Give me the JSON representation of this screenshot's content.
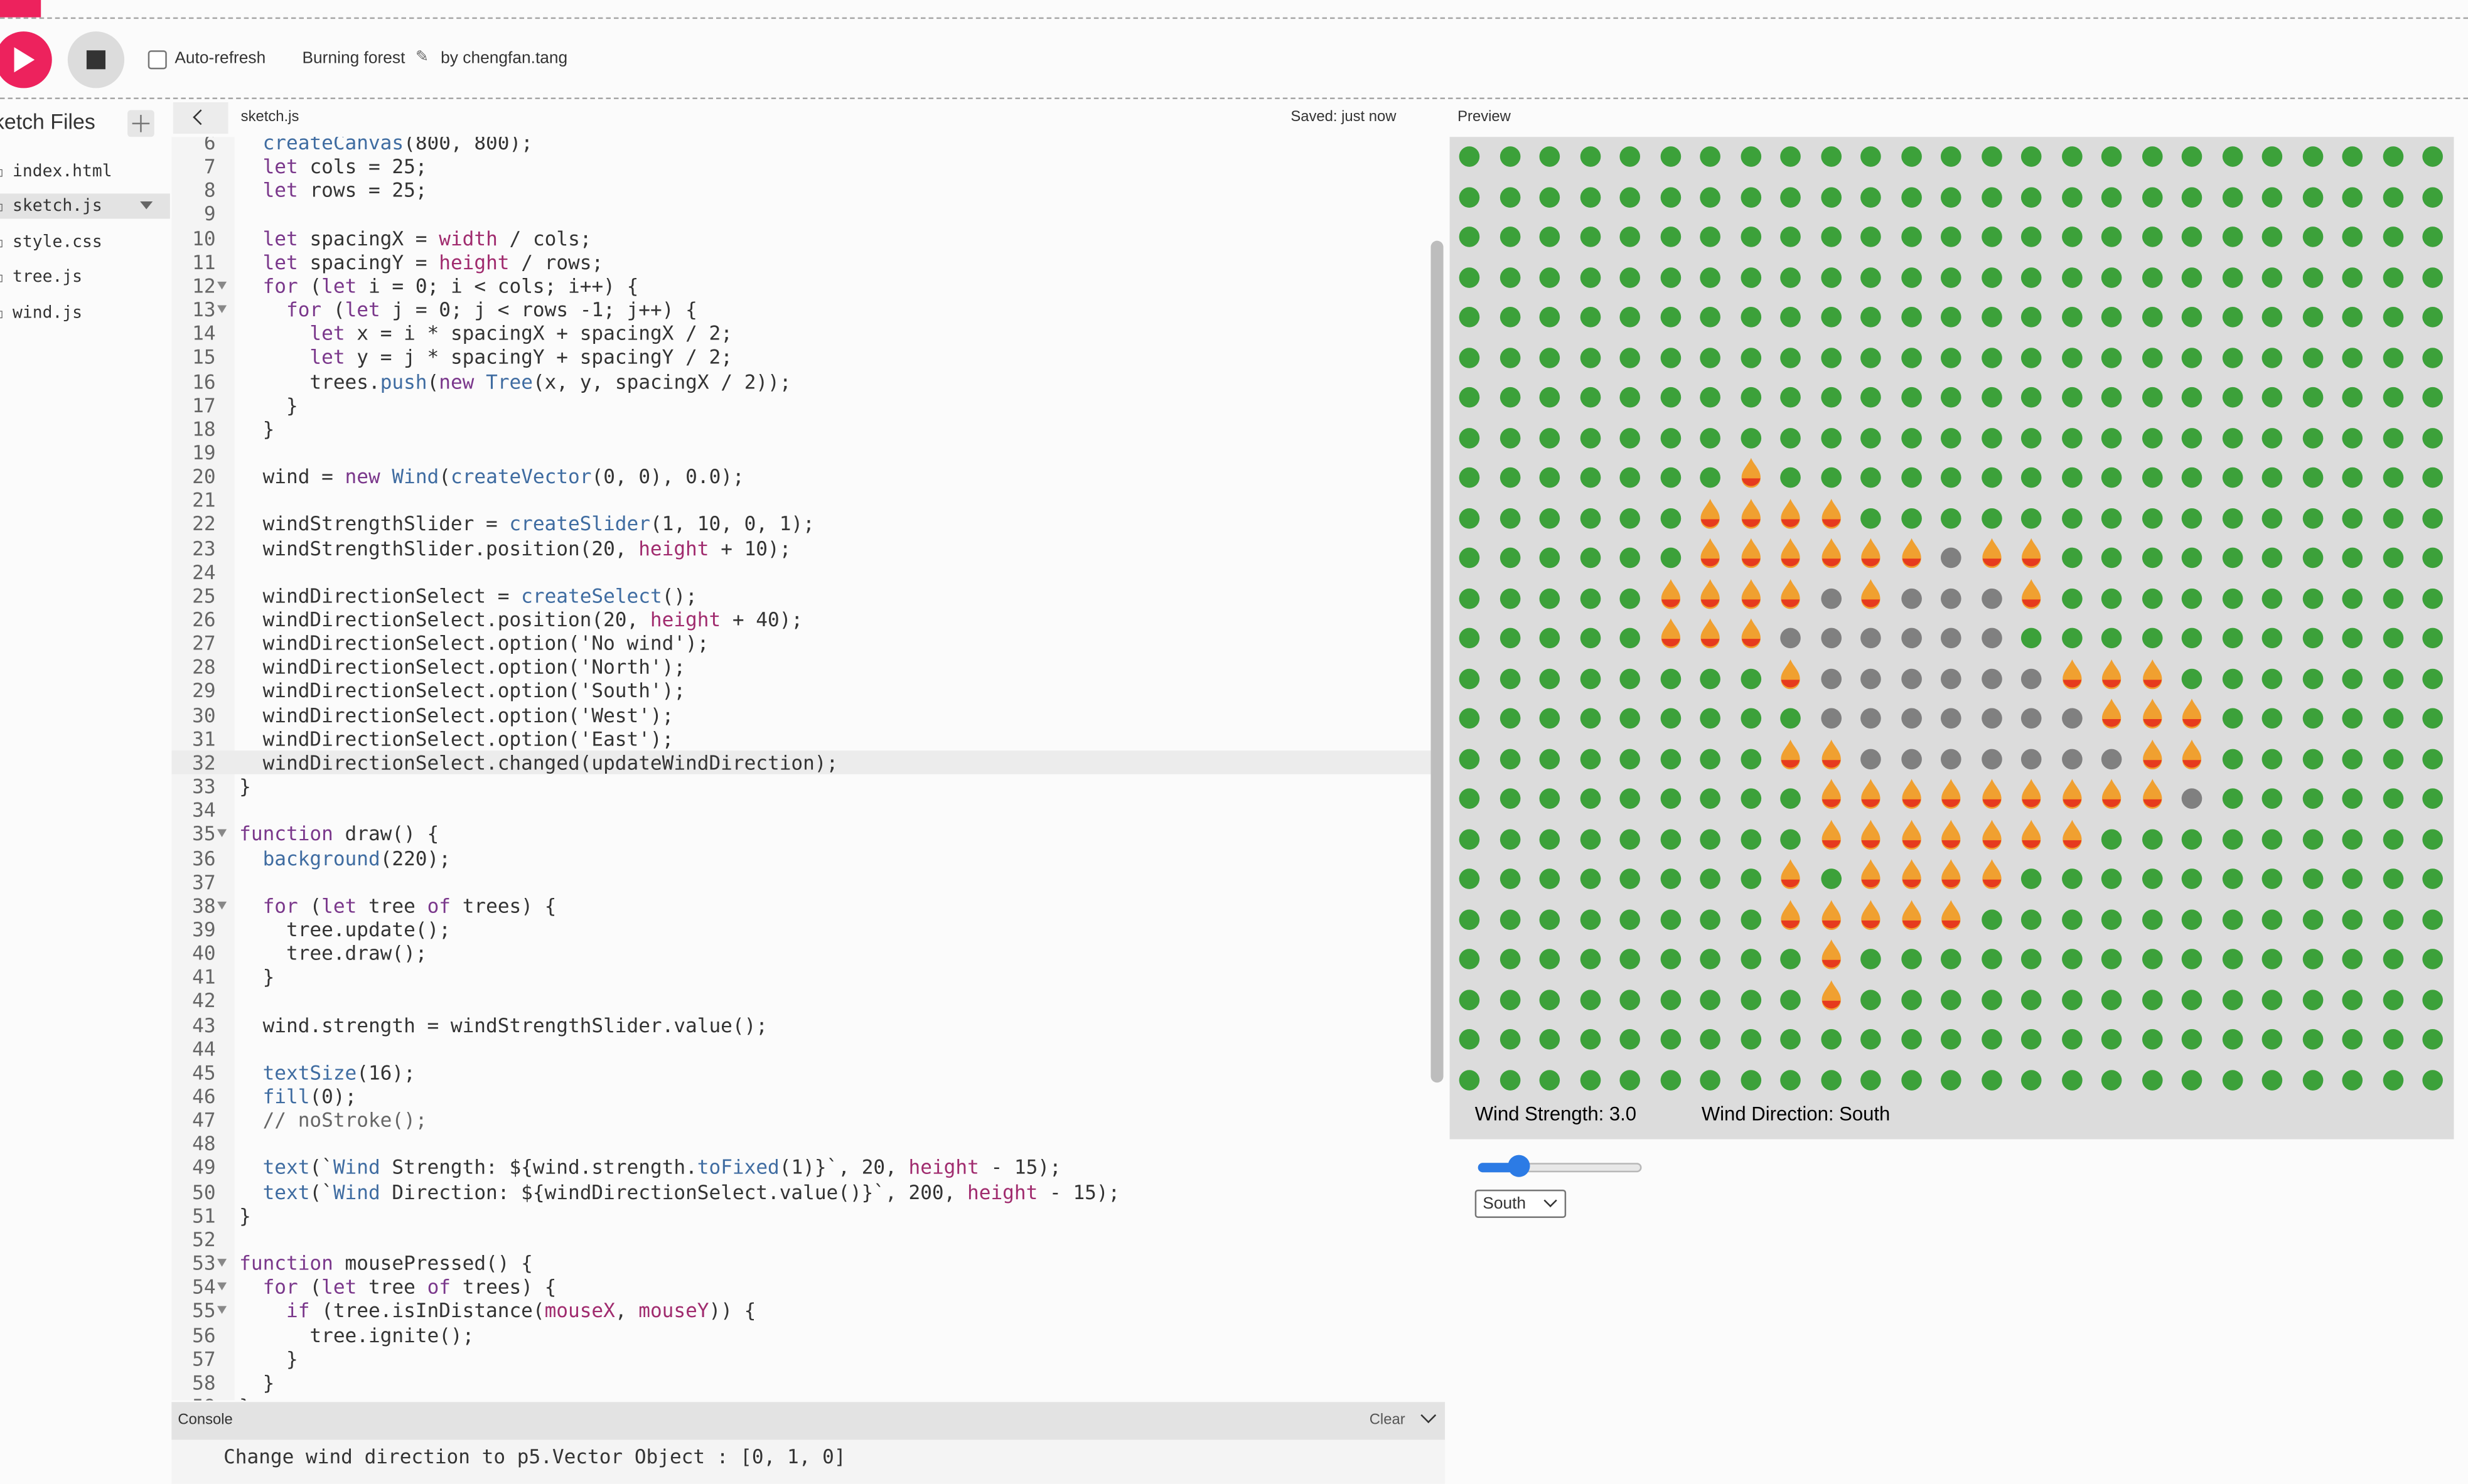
{
  "toolbar": {
    "auto_refresh_label": "Auto-refresh",
    "auto_refresh_checked": false,
    "sketch_name": "Burning forest",
    "author": "by chengfan.tang"
  },
  "sidebar": {
    "title": "ketch Files",
    "files": [
      {
        "name": "index.html",
        "icon": "file-icon",
        "selected": false
      },
      {
        "name": "sketch.js",
        "icon": "file-icon",
        "selected": true
      },
      {
        "name": "style.css",
        "icon": "file-icon",
        "selected": false
      },
      {
        "name": "tree.js",
        "icon": "file-icon",
        "selected": false
      },
      {
        "name": "wind.js",
        "icon": "file-icon",
        "selected": false
      }
    ]
  },
  "editor": {
    "tab_name": "sketch.js",
    "saved_status": "Saved: just now",
    "active_line": 32,
    "lines": [
      {
        "n": 6,
        "code": "  createCanvas(800, 800);"
      },
      {
        "n": 7,
        "code": "  let cols = 25;"
      },
      {
        "n": 8,
        "code": "  let rows = 25;"
      },
      {
        "n": 9,
        "code": ""
      },
      {
        "n": 10,
        "code": "  let spacingX = width / cols;"
      },
      {
        "n": 11,
        "code": "  let spacingY = height / rows;"
      },
      {
        "n": 12,
        "code": "  for (let i = 0; i < cols; i++) {",
        "fold": true
      },
      {
        "n": 13,
        "code": "    for (let j = 0; j < rows -1; j++) {",
        "fold": true
      },
      {
        "n": 14,
        "code": "      let x = i * spacingX + spacingX / 2;"
      },
      {
        "n": 15,
        "code": "      let y = j * spacingY + spacingY / 2;"
      },
      {
        "n": 16,
        "code": "      trees.push(new Tree(x, y, spacingX / 2));"
      },
      {
        "n": 17,
        "code": "    }"
      },
      {
        "n": 18,
        "code": "  }"
      },
      {
        "n": 19,
        "code": ""
      },
      {
        "n": 20,
        "code": "  wind = new Wind(createVector(0, 0), 0.0);"
      },
      {
        "n": 21,
        "code": ""
      },
      {
        "n": 22,
        "code": "  windStrengthSlider = createSlider(1, 10, 0, 1);"
      },
      {
        "n": 23,
        "code": "  windStrengthSlider.position(20, height + 10);"
      },
      {
        "n": 24,
        "code": ""
      },
      {
        "n": 25,
        "code": "  windDirectionSelect = createSelect();"
      },
      {
        "n": 26,
        "code": "  windDirectionSelect.position(20, height + 40);"
      },
      {
        "n": 27,
        "code": "  windDirectionSelect.option('No wind');"
      },
      {
        "n": 28,
        "code": "  windDirectionSelect.option('North');"
      },
      {
        "n": 29,
        "code": "  windDirectionSelect.option('South');"
      },
      {
        "n": 30,
        "code": "  windDirectionSelect.option('West');"
      },
      {
        "n": 31,
        "code": "  windDirectionSelect.option('East');"
      },
      {
        "n": 32,
        "code": "  windDirectionSelect.changed(updateWindDirection);"
      },
      {
        "n": 33,
        "code": "}"
      },
      {
        "n": 34,
        "code": ""
      },
      {
        "n": 35,
        "code": "function draw() {",
        "fold": true
      },
      {
        "n": 36,
        "code": "  background(220);"
      },
      {
        "n": 37,
        "code": ""
      },
      {
        "n": 38,
        "code": "  for (let tree of trees) {",
        "fold": true
      },
      {
        "n": 39,
        "code": "    tree.update();"
      },
      {
        "n": 40,
        "code": "    tree.draw();"
      },
      {
        "n": 41,
        "code": "  }"
      },
      {
        "n": 42,
        "code": ""
      },
      {
        "n": 43,
        "code": "  wind.strength = windStrengthSlider.value();"
      },
      {
        "n": 44,
        "code": ""
      },
      {
        "n": 45,
        "code": "  textSize(16);"
      },
      {
        "n": 46,
        "code": "  fill(0);"
      },
      {
        "n": 47,
        "code": "  // noStroke();"
      },
      {
        "n": 48,
        "code": ""
      },
      {
        "n": 49,
        "code": "  text(`Wind Strength: ${wind.strength.toFixed(1)}`, 20, height - 15);"
      },
      {
        "n": 50,
        "code": "  text(`Wind Direction: ${windDirectionSelect.value()}`, 200, height - 15);"
      },
      {
        "n": 51,
        "code": "}"
      },
      {
        "n": 52,
        "code": ""
      },
      {
        "n": 53,
        "code": "function mousePressed() {",
        "fold": true
      },
      {
        "n": 54,
        "code": "  for (let tree of trees) {",
        "fold": true
      },
      {
        "n": 55,
        "code": "    if (tree.isInDistance(mouseX, mouseY)) {",
        "fold": true
      },
      {
        "n": 56,
        "code": "      tree.ignite();"
      },
      {
        "n": 57,
        "code": "    }"
      },
      {
        "n": 58,
        "code": "  }"
      },
      {
        "n": 59,
        "code": "}"
      }
    ]
  },
  "console": {
    "title": "Console",
    "clear_label": "Clear",
    "message": "Change wind direction to p5.Vector Object : [0, 1, 0]"
  },
  "preview": {
    "title": "Preview",
    "wind_strength_text": "Wind Strength: 3.0",
    "wind_direction_text": "Wind Direction: South",
    "slider": {
      "min": 1,
      "max": 10,
      "value": 3
    },
    "direction_select": "South",
    "grid_cols": 25,
    "grid_rows": 24,
    "burning_cells": [
      [
        8,
        7
      ],
      [
        9,
        6
      ],
      [
        9,
        7
      ],
      [
        9,
        8
      ],
      [
        9,
        9
      ],
      [
        10,
        6
      ],
      [
        10,
        7
      ],
      [
        10,
        8
      ],
      [
        10,
        9
      ],
      [
        10,
        10
      ],
      [
        10,
        11
      ],
      [
        10,
        13
      ],
      [
        10,
        14
      ],
      [
        11,
        5
      ],
      [
        11,
        6
      ],
      [
        11,
        7
      ],
      [
        11,
        8
      ],
      [
        11,
        10
      ],
      [
        11,
        14
      ],
      [
        12,
        5
      ],
      [
        12,
        6
      ],
      [
        12,
        7
      ],
      [
        13,
        8
      ],
      [
        13,
        15
      ],
      [
        13,
        16
      ],
      [
        13,
        17
      ],
      [
        14,
        16
      ],
      [
        14,
        17
      ],
      [
        14,
        18
      ],
      [
        15,
        8
      ],
      [
        15,
        9
      ],
      [
        15,
        17
      ],
      [
        15,
        18
      ],
      [
        16,
        9
      ],
      [
        16,
        10
      ],
      [
        16,
        11
      ],
      [
        16,
        12
      ],
      [
        16,
        13
      ],
      [
        16,
        14
      ],
      [
        16,
        15
      ],
      [
        16,
        16
      ],
      [
        16,
        17
      ],
      [
        17,
        9
      ],
      [
        17,
        10
      ],
      [
        17,
        11
      ],
      [
        17,
        12
      ],
      [
        17,
        13
      ],
      [
        17,
        14
      ],
      [
        17,
        15
      ],
      [
        18,
        8
      ],
      [
        18,
        10
      ],
      [
        18,
        11
      ],
      [
        18,
        12
      ],
      [
        18,
        13
      ],
      [
        19,
        8
      ],
      [
        19,
        9
      ],
      [
        19,
        10
      ],
      [
        19,
        11
      ],
      [
        19,
        12
      ],
      [
        20,
        9
      ],
      [
        21,
        9
      ]
    ],
    "burnt_cells": [
      [
        10,
        12
      ],
      [
        11,
        9
      ],
      [
        11,
        11
      ],
      [
        11,
        12
      ],
      [
        11,
        13
      ],
      [
        12,
        8
      ],
      [
        12,
        9
      ],
      [
        12,
        10
      ],
      [
        12,
        11
      ],
      [
        12,
        12
      ],
      [
        12,
        13
      ],
      [
        13,
        9
      ],
      [
        13,
        10
      ],
      [
        13,
        11
      ],
      [
        13,
        12
      ],
      [
        13,
        13
      ],
      [
        13,
        14
      ],
      [
        14,
        9
      ],
      [
        14,
        10
      ],
      [
        14,
        11
      ],
      [
        14,
        12
      ],
      [
        14,
        13
      ],
      [
        14,
        14
      ],
      [
        14,
        15
      ],
      [
        15,
        10
      ],
      [
        15,
        11
      ],
      [
        15,
        12
      ],
      [
        15,
        13
      ],
      [
        15,
        14
      ],
      [
        15,
        15
      ],
      [
        15,
        16
      ],
      [
        16,
        18
      ]
    ]
  },
  "colors": {
    "accent": "#ed225d",
    "tree_healthy": "#3ca13a",
    "tree_burnt": "#808080",
    "flame_outer": "#f0a030",
    "flame_inner": "#e63a1e"
  }
}
